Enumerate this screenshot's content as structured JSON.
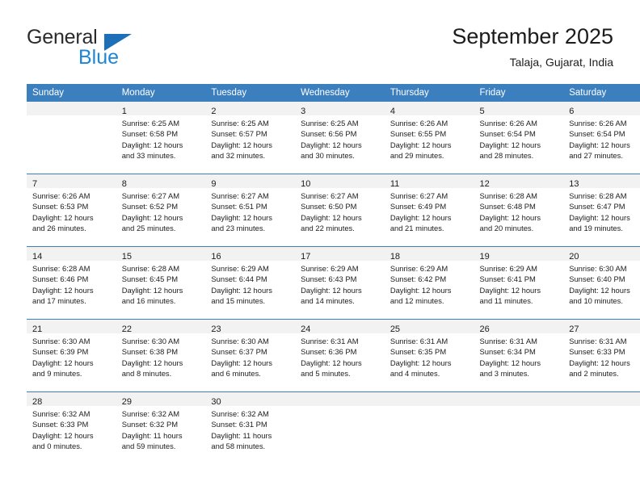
{
  "brand": {
    "name_top": "General",
    "name_bottom": "Blue",
    "triangle_icon": "triangle-icon",
    "color_dark": "#2b2b2b",
    "color_blue": "#1d86d6",
    "color_triangle": "#1d70b8"
  },
  "header": {
    "title": "September 2025",
    "subtitle": "Talaja, Gujarat, India"
  },
  "theme": {
    "header_row_bg": "#3c7fbf",
    "header_row_text": "#ffffff",
    "daynum_band_bg": "#f2f2f2",
    "cell_bg": "#ffffff",
    "divider": "#3c7fbf",
    "text": "#1c1c1c"
  },
  "calendar": {
    "weekday_headers": [
      "Sunday",
      "Monday",
      "Tuesday",
      "Wednesday",
      "Thursday",
      "Friday",
      "Saturday"
    ],
    "weeks": [
      [
        {
          "day": "",
          "lines": []
        },
        {
          "day": "1",
          "lines": [
            "Sunrise: 6:25 AM",
            "Sunset: 6:58 PM",
            "Daylight: 12 hours",
            "and 33 minutes."
          ]
        },
        {
          "day": "2",
          "lines": [
            "Sunrise: 6:25 AM",
            "Sunset: 6:57 PM",
            "Daylight: 12 hours",
            "and 32 minutes."
          ]
        },
        {
          "day": "3",
          "lines": [
            "Sunrise: 6:25 AM",
            "Sunset: 6:56 PM",
            "Daylight: 12 hours",
            "and 30 minutes."
          ]
        },
        {
          "day": "4",
          "lines": [
            "Sunrise: 6:26 AM",
            "Sunset: 6:55 PM",
            "Daylight: 12 hours",
            "and 29 minutes."
          ]
        },
        {
          "day": "5",
          "lines": [
            "Sunrise: 6:26 AM",
            "Sunset: 6:54 PM",
            "Daylight: 12 hours",
            "and 28 minutes."
          ]
        },
        {
          "day": "6",
          "lines": [
            "Sunrise: 6:26 AM",
            "Sunset: 6:54 PM",
            "Daylight: 12 hours",
            "and 27 minutes."
          ]
        }
      ],
      [
        {
          "day": "7",
          "lines": [
            "Sunrise: 6:26 AM",
            "Sunset: 6:53 PM",
            "Daylight: 12 hours",
            "and 26 minutes."
          ]
        },
        {
          "day": "8",
          "lines": [
            "Sunrise: 6:27 AM",
            "Sunset: 6:52 PM",
            "Daylight: 12 hours",
            "and 25 minutes."
          ]
        },
        {
          "day": "9",
          "lines": [
            "Sunrise: 6:27 AM",
            "Sunset: 6:51 PM",
            "Daylight: 12 hours",
            "and 23 minutes."
          ]
        },
        {
          "day": "10",
          "lines": [
            "Sunrise: 6:27 AM",
            "Sunset: 6:50 PM",
            "Daylight: 12 hours",
            "and 22 minutes."
          ]
        },
        {
          "day": "11",
          "lines": [
            "Sunrise: 6:27 AM",
            "Sunset: 6:49 PM",
            "Daylight: 12 hours",
            "and 21 minutes."
          ]
        },
        {
          "day": "12",
          "lines": [
            "Sunrise: 6:28 AM",
            "Sunset: 6:48 PM",
            "Daylight: 12 hours",
            "and 20 minutes."
          ]
        },
        {
          "day": "13",
          "lines": [
            "Sunrise: 6:28 AM",
            "Sunset: 6:47 PM",
            "Daylight: 12 hours",
            "and 19 minutes."
          ]
        }
      ],
      [
        {
          "day": "14",
          "lines": [
            "Sunrise: 6:28 AM",
            "Sunset: 6:46 PM",
            "Daylight: 12 hours",
            "and 17 minutes."
          ]
        },
        {
          "day": "15",
          "lines": [
            "Sunrise: 6:28 AM",
            "Sunset: 6:45 PM",
            "Daylight: 12 hours",
            "and 16 minutes."
          ]
        },
        {
          "day": "16",
          "lines": [
            "Sunrise: 6:29 AM",
            "Sunset: 6:44 PM",
            "Daylight: 12 hours",
            "and 15 minutes."
          ]
        },
        {
          "day": "17",
          "lines": [
            "Sunrise: 6:29 AM",
            "Sunset: 6:43 PM",
            "Daylight: 12 hours",
            "and 14 minutes."
          ]
        },
        {
          "day": "18",
          "lines": [
            "Sunrise: 6:29 AM",
            "Sunset: 6:42 PM",
            "Daylight: 12 hours",
            "and 12 minutes."
          ]
        },
        {
          "day": "19",
          "lines": [
            "Sunrise: 6:29 AM",
            "Sunset: 6:41 PM",
            "Daylight: 12 hours",
            "and 11 minutes."
          ]
        },
        {
          "day": "20",
          "lines": [
            "Sunrise: 6:30 AM",
            "Sunset: 6:40 PM",
            "Daylight: 12 hours",
            "and 10 minutes."
          ]
        }
      ],
      [
        {
          "day": "21",
          "lines": [
            "Sunrise: 6:30 AM",
            "Sunset: 6:39 PM",
            "Daylight: 12 hours",
            "and 9 minutes."
          ]
        },
        {
          "day": "22",
          "lines": [
            "Sunrise: 6:30 AM",
            "Sunset: 6:38 PM",
            "Daylight: 12 hours",
            "and 8 minutes."
          ]
        },
        {
          "day": "23",
          "lines": [
            "Sunrise: 6:30 AM",
            "Sunset: 6:37 PM",
            "Daylight: 12 hours",
            "and 6 minutes."
          ]
        },
        {
          "day": "24",
          "lines": [
            "Sunrise: 6:31 AM",
            "Sunset: 6:36 PM",
            "Daylight: 12 hours",
            "and 5 minutes."
          ]
        },
        {
          "day": "25",
          "lines": [
            "Sunrise: 6:31 AM",
            "Sunset: 6:35 PM",
            "Daylight: 12 hours",
            "and 4 minutes."
          ]
        },
        {
          "day": "26",
          "lines": [
            "Sunrise: 6:31 AM",
            "Sunset: 6:34 PM",
            "Daylight: 12 hours",
            "and 3 minutes."
          ]
        },
        {
          "day": "27",
          "lines": [
            "Sunrise: 6:31 AM",
            "Sunset: 6:33 PM",
            "Daylight: 12 hours",
            "and 2 minutes."
          ]
        }
      ],
      [
        {
          "day": "28",
          "lines": [
            "Sunrise: 6:32 AM",
            "Sunset: 6:33 PM",
            "Daylight: 12 hours",
            "and 0 minutes."
          ]
        },
        {
          "day": "29",
          "lines": [
            "Sunrise: 6:32 AM",
            "Sunset: 6:32 PM",
            "Daylight: 11 hours",
            "and 59 minutes."
          ]
        },
        {
          "day": "30",
          "lines": [
            "Sunrise: 6:32 AM",
            "Sunset: 6:31 PM",
            "Daylight: 11 hours",
            "and 58 minutes."
          ]
        },
        {
          "day": "",
          "lines": []
        },
        {
          "day": "",
          "lines": []
        },
        {
          "day": "",
          "lines": []
        },
        {
          "day": "",
          "lines": []
        }
      ]
    ]
  }
}
